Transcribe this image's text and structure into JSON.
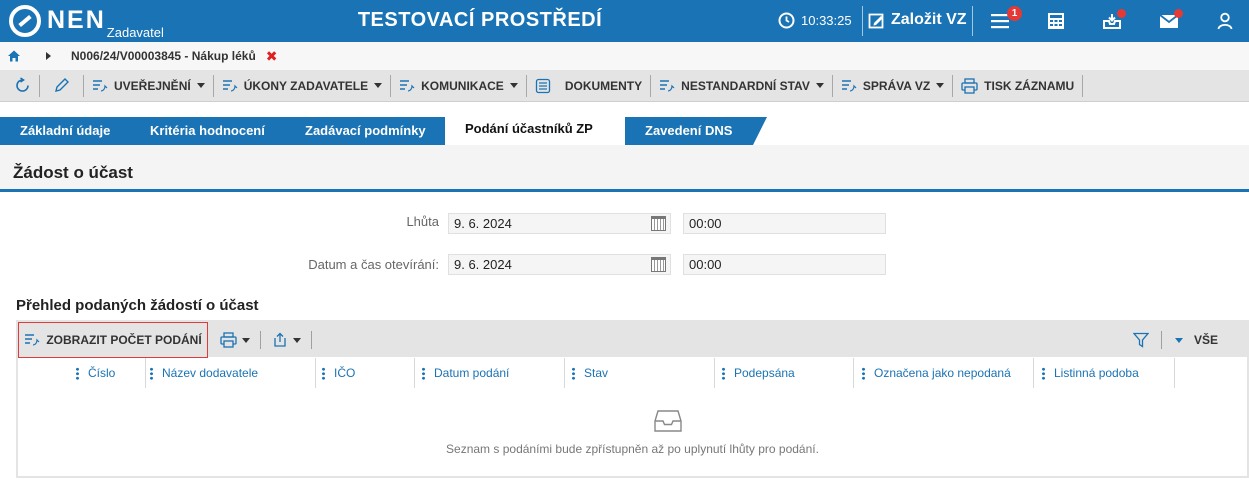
{
  "header": {
    "logo_text": "NEN",
    "logo_sub": "Zadavatel",
    "environment": "TESTOVACÍ PROSTŘEDÍ",
    "time": "10:33:25",
    "create_label": "Založit VZ",
    "notifications_count": "1",
    "accent_color": "#1a73b4",
    "badge_color": "#e53935"
  },
  "breadcrumb": {
    "path": "N006/24/V00003845 - Nákup léků",
    "close_symbol": "✖"
  },
  "toolbar": {
    "items": [
      {
        "label": "UVEŘEJNĚNÍ"
      },
      {
        "label": "ÚKONY ZADAVATELE"
      },
      {
        "label": "KOMUNIKACE"
      },
      {
        "label": "DOKUMENTY"
      },
      {
        "label": "NESTANDARDNÍ STAV"
      },
      {
        "label": "SPRÁVA VZ"
      },
      {
        "label": "TISK ZÁZNAMU"
      }
    ]
  },
  "tabs": [
    {
      "label": "Základní údaje",
      "active": false
    },
    {
      "label": "Kritéria hodnocení",
      "active": false
    },
    {
      "label": "Zadávací podmínky",
      "active": false
    },
    {
      "label": "Podání účastníků ZP",
      "active": true
    },
    {
      "label": "Zavedení DNS",
      "active": false
    }
  ],
  "section": {
    "title": "Žádost o účast"
  },
  "form": {
    "deadline_label": "Lhůta",
    "deadline_date": "9. 6. 2024",
    "deadline_time": "00:00",
    "opening_label": "Datum a čas otevírání:",
    "opening_date": "9. 6. 2024",
    "opening_time": "00:00"
  },
  "overview": {
    "title": "Přehled podaných žádostí o účast",
    "count_button": "ZOBRAZIT POČET PODÁNÍ",
    "filter_all": "VŠE",
    "columns": [
      "Číslo",
      "Název dodavatele",
      "IČO",
      "Datum podání",
      "Stav",
      "Podepsána",
      "Označena jako nepodaná",
      "Listinná podoba"
    ],
    "empty_message": "Seznam s podáními bude zpřístupněn až po uplynutí lhůty pro podání."
  }
}
